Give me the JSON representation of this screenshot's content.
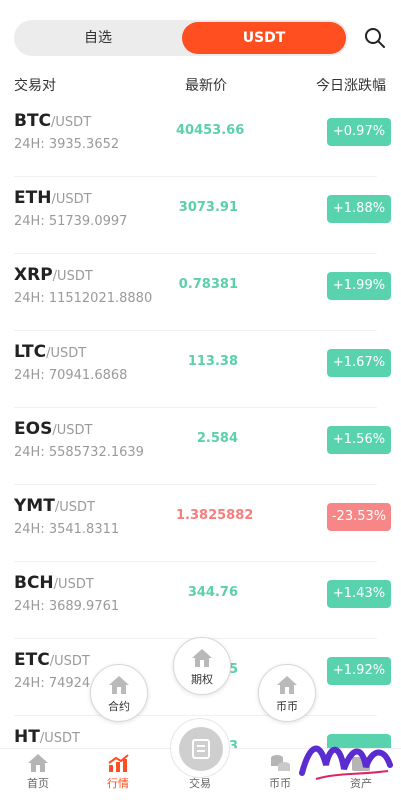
{
  "tabs": {
    "left": "自选",
    "right": "USDT"
  },
  "columns": {
    "pair": "交易对",
    "price": "最新价",
    "change": "今日涨跌幅"
  },
  "colors": {
    "accent": "#ff4e1f",
    "up": "#59d3ae",
    "down": "#f78787"
  },
  "rows": [
    {
      "base": "BTC",
      "quote": "/USDT",
      "vol": "24H: 3935.3652",
      "price": "40453.66",
      "change": "+0.97%",
      "dir": "up"
    },
    {
      "base": "ETH",
      "quote": "/USDT",
      "vol": "24H: 51739.0997",
      "price": "3073.91",
      "change": "+1.88%",
      "dir": "up"
    },
    {
      "base": "XRP",
      "quote": "/USDT",
      "vol": "24H: 11512021.8880",
      "price": "0.78381",
      "change": "+1.99%",
      "dir": "up"
    },
    {
      "base": "LTC",
      "quote": "/USDT",
      "vol": "24H: 70941.6868",
      "price": "113.38",
      "change": "+1.67%",
      "dir": "up"
    },
    {
      "base": "EOS",
      "quote": "/USDT",
      "vol": "24H: 5585732.1639",
      "price": "2.584",
      "change": "+1.56%",
      "dir": "up"
    },
    {
      "base": "YMT",
      "quote": "/USDT",
      "vol": "24H: 3541.8311",
      "price": "1.3825882",
      "change": "-23.53%",
      "dir": "down"
    },
    {
      "base": "BCH",
      "quote": "/USDT",
      "vol": "24H: 3689.9761",
      "price": "344.76",
      "change": "+1.43%",
      "dir": "up"
    },
    {
      "base": "ETC",
      "quote": "/USDT",
      "vol": "24H: 74924.9",
      "price": "5",
      "change": "+1.92%",
      "dir": "up"
    },
    {
      "base": "HT",
      "quote": "/USDT",
      "vol": "",
      "price": "3",
      "change": "",
      "dir": "up"
    }
  ],
  "fab": {
    "contract": "合约",
    "options": "期权",
    "coin": "币币"
  },
  "nav": {
    "home": "首页",
    "market": "行情",
    "trade": "交易",
    "coin": "币币",
    "asset": "资产"
  },
  "icons": {
    "search": "search-icon",
    "home": "home-icon",
    "market": "chart-icon",
    "trade": "wallet-icon",
    "coin": "coins-icon"
  }
}
